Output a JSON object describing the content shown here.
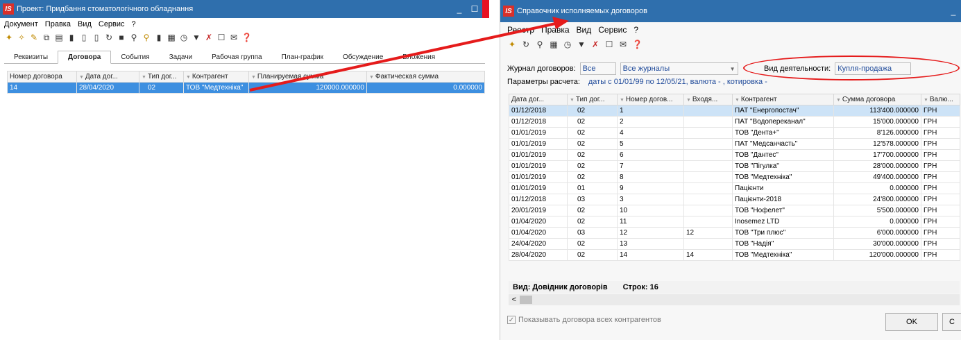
{
  "left_window": {
    "title": "Проект: Придбання стоматологічного обладнання",
    "minimize": "_",
    "maximize": "☐",
    "menu": [
      "Документ",
      "Правка",
      "Вид",
      "Сервис",
      "?"
    ],
    "tabs": [
      "Реквизиты",
      "Договора",
      "События",
      "Задачи",
      "Рабочая группа",
      "План-график",
      "Обсуждение",
      "Вложения"
    ],
    "active_tab": "Договора",
    "columns": [
      "Номер договора",
      "Дата дог...",
      "Тип дог...",
      "Контрагент",
      "Планируемая сумма",
      "Фактическая сумма"
    ],
    "rows": [
      [
        "14",
        "28/04/2020",
        "02",
        "ТОВ \"Медтехніка\"",
        "120000.000000",
        "0.000000"
      ]
    ]
  },
  "right_window": {
    "title": "Справочник исполняемых договоров",
    "minimize": "_",
    "menu": [
      "Реестр",
      "Правка",
      "Вид",
      "Сервис",
      "?"
    ],
    "journal_label": "Журнал договоров:",
    "journal_code": "Все",
    "journal_value": "Все журналы",
    "activity_label": "Вид деятельности:",
    "activity_value": "Купля-продажа",
    "params_label": "Параметры расчета:",
    "params_value": "даты с 01/01/99 по 12/05/21, валюта - , котировка -",
    "columns": [
      "Дата дог...",
      "Тип дог...",
      "Номер догов...",
      "Входя...",
      "Контрагент",
      "Сумма договора",
      "Валю..."
    ],
    "rows": [
      [
        "01/12/2018",
        "02",
        "1",
        "",
        "ПАТ \"Енергопостач\"",
        "113'400.000000",
        "ГРН"
      ],
      [
        "01/12/2018",
        "02",
        "2",
        "",
        "ПАТ \"Водопереканал\"",
        "15'000.000000",
        "ГРН"
      ],
      [
        "01/01/2019",
        "02",
        "4",
        "",
        "ТОВ \"Дента+\"",
        "8'126.000000",
        "ГРН"
      ],
      [
        "01/01/2019",
        "02",
        "5",
        "",
        "ПАТ \"Медсанчасть\"",
        "12'578.000000",
        "ГРН"
      ],
      [
        "01/01/2019",
        "02",
        "6",
        "",
        "ТОВ \"Дантес\"",
        "17'700.000000",
        "ГРН"
      ],
      [
        "01/01/2019",
        "02",
        "7",
        "",
        "ТОВ \"Пігулка\"",
        "28'000.000000",
        "ГРН"
      ],
      [
        "01/01/2019",
        "02",
        "8",
        "",
        "ТОВ \"Медтехніка\"",
        "49'400.000000",
        "ГРН"
      ],
      [
        "01/01/2019",
        "01",
        "9",
        "",
        "Пацієнти",
        "0.000000",
        "ГРН"
      ],
      [
        "01/12/2018",
        "03",
        "3",
        "",
        "Пацієнти-2018",
        "24'800.000000",
        "ГРН"
      ],
      [
        "20/01/2019",
        "02",
        "10",
        "",
        "ТОВ \"Нофелет\"",
        "5'500.000000",
        "ГРН"
      ],
      [
        "01/04/2020",
        "02",
        "11",
        "",
        "Inosemez LTD",
        "0.000000",
        "ГРН"
      ],
      [
        "01/04/2020",
        "03",
        "12",
        "12",
        "ТОВ \"Три плюс\"",
        "6'000.000000",
        "ГРН"
      ],
      [
        "24/04/2020",
        "02",
        "13",
        "",
        "ТОВ \"Надія\"",
        "30'000.000000",
        "ГРН"
      ],
      [
        "28/04/2020",
        "02",
        "14",
        "14",
        "ТОВ \"Медтехніка\"",
        "120'000.000000",
        "ГРН"
      ]
    ],
    "status_view": "Вид: Довідник договорів",
    "status_rows": "Строк: 16",
    "scroll_left": "<",
    "show_all_checkbox": "Показывать договора всех контрагентов",
    "ok_label": "OK",
    "cancel_label": "C"
  },
  "colors": {
    "titlebar": "#2f6fad",
    "selection": "#cde3f7",
    "arrow": "#e51b1b",
    "highlight_ellipse": "#e51b1b"
  }
}
